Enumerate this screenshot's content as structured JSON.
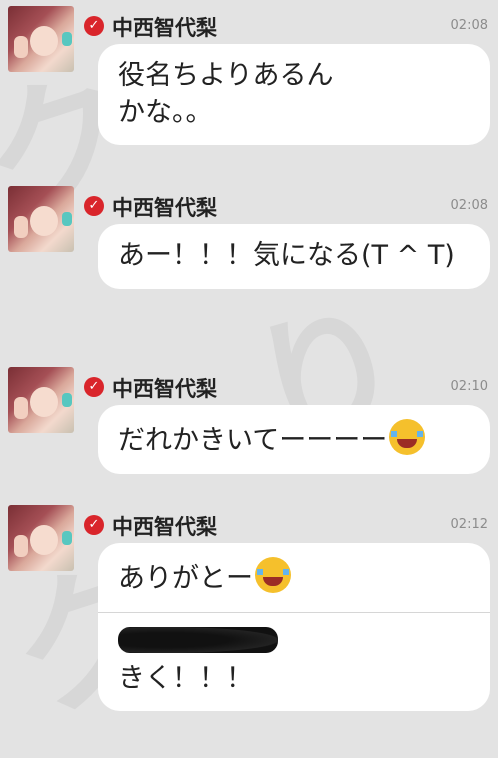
{
  "messages": [
    {
      "sender": "中西智代梨",
      "time": "02:08",
      "text": "役名ちよりあるんかな。。",
      "emoji": "",
      "extra": ""
    },
    {
      "sender": "中西智代梨",
      "time": "02:08",
      "text": "あー！！！気になる(T ^ T)",
      "emoji": "",
      "extra": ""
    },
    {
      "sender": "中西智代梨",
      "time": "02:10",
      "text": "だれかきいてーーーー",
      "emoji": "face-with-tears-of-joy",
      "extra": ""
    },
    {
      "sender": "中西智代梨",
      "time": "02:12",
      "text": "ありがとー",
      "emoji": "face-with-tears-of-joy",
      "extra": "きく！！！"
    }
  ],
  "colors": {
    "background": "#e3e3e3",
    "bubble": "#ffffff",
    "verified_badge": "#d9252b",
    "timestamp": "#8c8c8c"
  },
  "icons": {
    "verified": "check-icon",
    "emoji": "face-with-tears-of-joy"
  }
}
